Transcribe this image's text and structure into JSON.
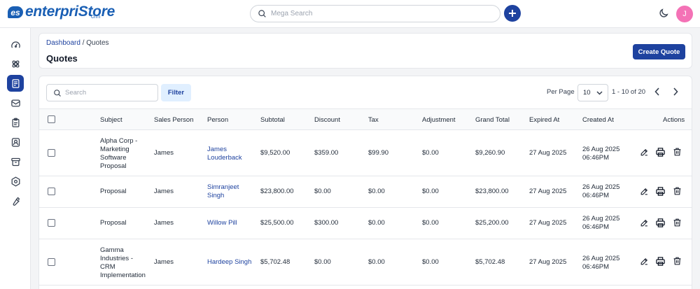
{
  "app": {
    "logo_badge": "es",
    "logo_text": "enterpriStore",
    "logo_sub": "crm",
    "search_placeholder": "Mega Search",
    "avatar_initial": "J"
  },
  "breadcrumb": {
    "root": "Dashboard",
    "separator": " / ",
    "current": "Quotes"
  },
  "page": {
    "title": "Quotes",
    "create_label": "Create Quote"
  },
  "toolbar": {
    "search_placeholder": "Search",
    "filter_label": "Filter",
    "per_page_label": "Per Page",
    "per_page_value": "10",
    "page_range": "1 - 10 of 20"
  },
  "table": {
    "headers": {
      "subject": "Subject",
      "sales_person": "Sales Person",
      "person": "Person",
      "subtotal": "Subtotal",
      "discount": "Discount",
      "tax": "Tax",
      "adjustment": "Adjustment",
      "grand_total": "Grand Total",
      "expired_at": "Expired At",
      "created_at": "Created At",
      "actions": "Actions"
    },
    "rows": [
      {
        "subject": [
          "Alpha Corp -",
          "Marketing",
          "Software",
          "Proposal"
        ],
        "sales_person": "James",
        "person": [
          "James",
          "Louderback"
        ],
        "subtotal": "$9,520.00",
        "discount": "$359.00",
        "tax": "$99.90",
        "adjustment": "$0.00",
        "grand_total": "$9,260.90",
        "expired_at": "27 Aug 2025",
        "created_at": [
          "26 Aug 2025",
          "06:46PM"
        ]
      },
      {
        "subject": [
          "Proposal"
        ],
        "sales_person": "James",
        "person": [
          "Simranjeet",
          "Singh"
        ],
        "subtotal": "$23,800.00",
        "discount": "$0.00",
        "tax": "$0.00",
        "adjustment": "$0.00",
        "grand_total": "$23,800.00",
        "expired_at": "27 Aug 2025",
        "created_at": [
          "26 Aug 2025",
          "06:46PM"
        ]
      },
      {
        "subject": [
          "Proposal"
        ],
        "sales_person": "James",
        "person": [
          "Willow Pill"
        ],
        "subtotal": "$25,500.00",
        "discount": "$300.00",
        "tax": "$0.00",
        "adjustment": "$0.00",
        "grand_total": "$25,200.00",
        "expired_at": "27 Aug 2025",
        "created_at": [
          "26 Aug 2025",
          "06:46PM"
        ]
      },
      {
        "subject": [
          "Gamma",
          "Industries -",
          "CRM",
          "Implementation"
        ],
        "sales_person": "James",
        "person": [
          "Hardeep Singh"
        ],
        "subtotal": "$5,702.48",
        "discount": "$0.00",
        "tax": "$0.00",
        "adjustment": "$0.00",
        "grand_total": "$5,702.48",
        "expired_at": "27 Aug 2025",
        "created_at": [
          "26 Aug 2025",
          "06:46PM"
        ]
      }
    ]
  },
  "sidebar": {
    "items": [
      {
        "icon": "dashboard-gauge-icon",
        "active": false
      },
      {
        "icon": "leads-icon",
        "active": false
      },
      {
        "icon": "quotes-icon",
        "active": true
      },
      {
        "icon": "mail-icon",
        "active": false
      },
      {
        "icon": "activities-clipboard-icon",
        "active": false
      },
      {
        "icon": "contacts-icon",
        "active": false
      },
      {
        "icon": "products-box-icon",
        "active": false
      },
      {
        "icon": "settings-icon",
        "active": false
      },
      {
        "icon": "configuration-wrench-icon",
        "active": false
      }
    ]
  },
  "colors": {
    "primary": "#1e429f",
    "brand": "#1a5fb4",
    "avatar": "#f472b6",
    "filter_bg": "#e0efff"
  }
}
